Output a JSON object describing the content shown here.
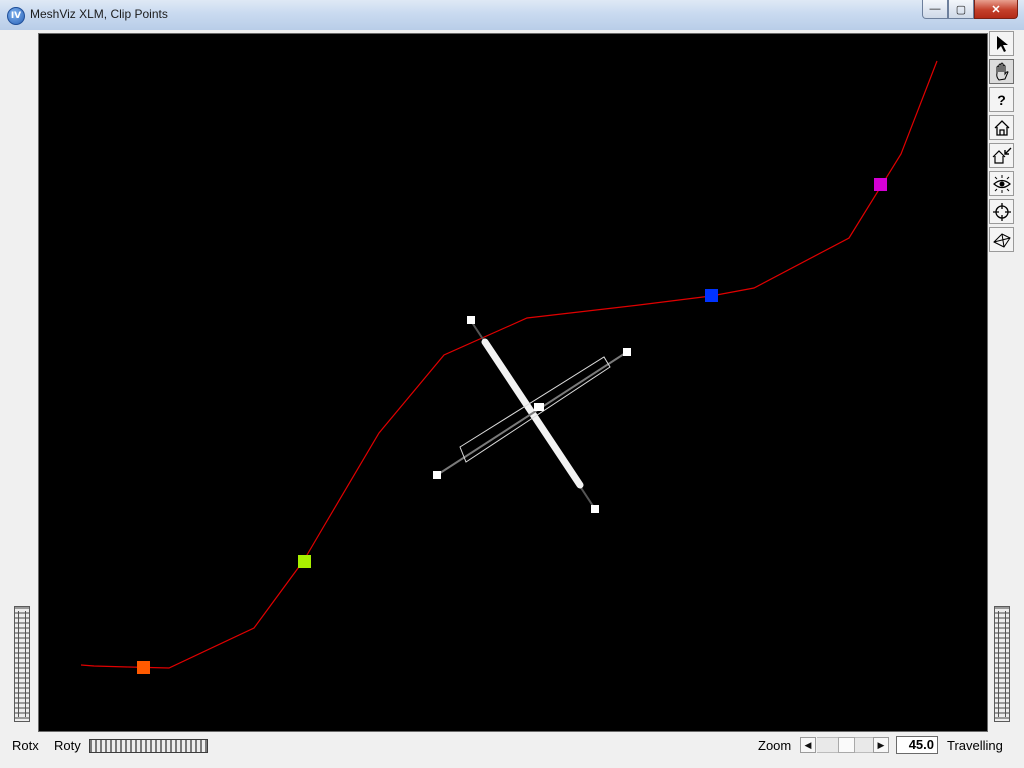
{
  "window": {
    "title": "MeshViz XLM, Clip Points",
    "icon_label": "IV",
    "minimize": "—",
    "maximize": "▢",
    "close": "✕"
  },
  "toolbar": {
    "tools": [
      {
        "name": "select-arrow-icon",
        "active": false
      },
      {
        "name": "hand-pan-icon",
        "active": true
      },
      {
        "name": "help-question-icon",
        "active": false
      },
      {
        "name": "home-icon",
        "active": false
      },
      {
        "name": "set-home-icon",
        "active": false
      },
      {
        "name": "view-all-eye-icon",
        "active": false
      },
      {
        "name": "seek-crosshair-icon",
        "active": false
      },
      {
        "name": "perspective-camera-icon",
        "active": false
      }
    ],
    "help_glyph": "?"
  },
  "scene": {
    "background": "#000000",
    "curve_color": "#e00000",
    "markers": [
      {
        "name": "orange-marker",
        "color": "#ff5a00"
      },
      {
        "name": "green-marker",
        "color": "#a8f000"
      },
      {
        "name": "blue-marker",
        "color": "#0033ff"
      },
      {
        "name": "magenta-marker",
        "color": "#d400d4"
      }
    ]
  },
  "bottom_bar": {
    "rotx_label": "Rotx",
    "roty_label": "Roty",
    "zoom_label": "Zoom",
    "zoom_value": "45.0",
    "mode_label": "Travelling",
    "left_arrow": "◀",
    "right_arrow": "▶"
  }
}
